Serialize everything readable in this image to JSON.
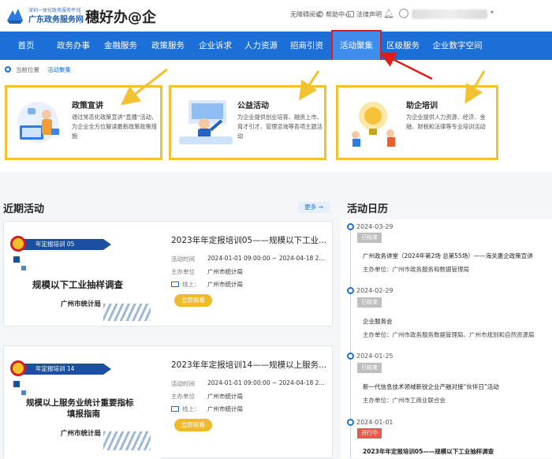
{
  "header": {
    "logo_small": "深圳一体化政务服务平台",
    "logo_name": "广东政务服务网",
    "brand": "穗好办@企",
    "tools": [
      "无障碍阅读",
      "帮助中心",
      "法律声明"
    ]
  },
  "nav": {
    "items": [
      "首页",
      "政务办事",
      "金融服务",
      "政策服务",
      "企业诉求",
      "人力资源",
      "招商引资",
      "活动聚集",
      "区级服务",
      "企业数字空间"
    ],
    "active_index": 7
  },
  "breadcrumb": {
    "label": "当前位置",
    "current": "活动聚集"
  },
  "cards": [
    {
      "title": "政策宣讲",
      "desc": "通过常态化政策宣讲“直播”活动，为企业全方位解读最新政策政策措施"
    },
    {
      "title": "公益活动",
      "desc": "为企业提供创业培育、融资上市、育才引才、管理咨询等各项主题活动"
    },
    {
      "title": "助企培训",
      "desc": "为企业提供人力资源、经济、金融、财税和法律等专业培训活动"
    }
  ],
  "recent": {
    "title": "近期活动",
    "more": "更多 →",
    "items": [
      {
        "ribbon": "年定报培训 05",
        "thumb_title": "规模以下工业抽样调查",
        "thumb_org": "广州市统计局",
        "title": "2023年年定报培训05——规模以下工业...",
        "time_label": "活动时间",
        "time": "2024-01-01 09:00:00 ~ 2024-04-18 2...",
        "host_label": "主办单位",
        "host": "广州市统计局",
        "online_label": "线上：",
        "online": "广州市统计局",
        "button": "立即观看"
      },
      {
        "ribbon": "年定报培训 14",
        "thumb_title": "规模以上服务业统计重要指标",
        "thumb_title2": "填报指南",
        "thumb_org": "广州市统计局",
        "title": "2023年年定报培训14——规模以上服务...",
        "time_label": "活动时间",
        "time": "2024-01-01 09:00:00 ~ 2024-04-18 2...",
        "host_label": "主办单位",
        "host": "广州市统计局",
        "online_label": "线上：",
        "online": "广州市统计局",
        "button": "立即观看"
      }
    ]
  },
  "calendar": {
    "title": "活动日历",
    "events": [
      {
        "date": "2024-03-29",
        "status": "已结束",
        "title": "广州政务讲堂（2024年第2场 总第55场）——海关惠企政策宣讲",
        "org": "主办单位：广州市政务服务和数据管理局"
      },
      {
        "date": "2024-02-29",
        "status": "已结束",
        "title": "企业服务会",
        "org": "主办单位：广州市政务服务数据管理局、广州市规划和自然资源局"
      },
      {
        "date": "2024-01-25",
        "status": "已结束",
        "title": "新一代信息技术领域新锐企业产融对接“伙伴日”活动",
        "org": "主办单位：广州市工商业联合会"
      },
      {
        "date": "2024-01-01",
        "status": "进行中",
        "title": "2023年年定报培训05——规模以下工业抽样调查",
        "org": ""
      }
    ]
  },
  "colors": {
    "brand_blue": "#1b6fd6",
    "highlight_red": "#e31a1a",
    "card_border": "#f2c232",
    "button": "#f1b92c"
  }
}
